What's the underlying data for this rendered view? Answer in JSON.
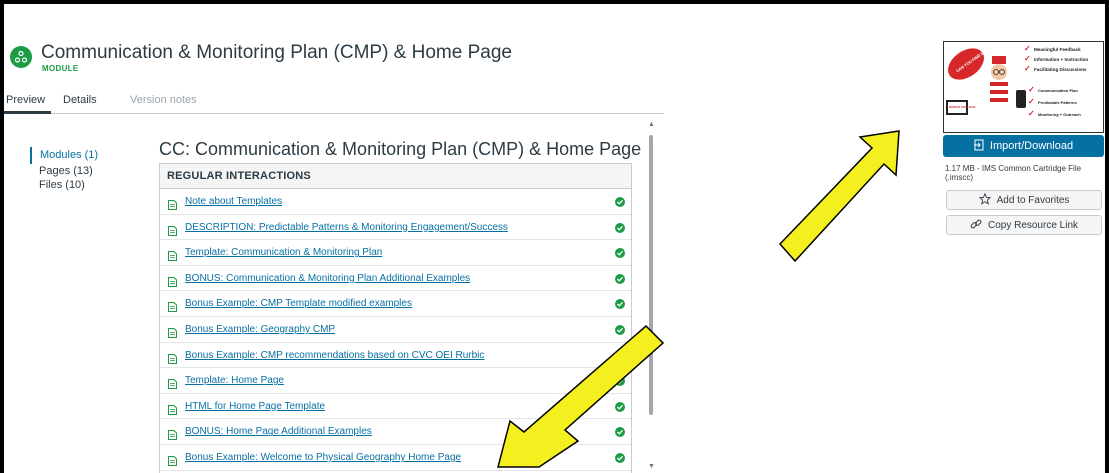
{
  "header": {
    "title": "Communication & Monitoring Plan (CMP) & Home Page",
    "type_badge": "MODULE",
    "icon": "module-icon"
  },
  "tabs": [
    {
      "label": "Preview",
      "active": true
    },
    {
      "label": "Details",
      "active": false
    },
    {
      "label": "Version notes",
      "active": false
    }
  ],
  "toc": [
    {
      "label": "Modules (1)",
      "active": true
    },
    {
      "label": "Pages (13)",
      "active": false
    },
    {
      "label": "Files (10)",
      "active": false
    }
  ],
  "preview": {
    "title": "CC: Communication & Monitoring Plan (CMP) & Home Page",
    "section_header": "REGULAR INTERACTIONS",
    "items": [
      {
        "label": "Note about Templates",
        "status": "complete"
      },
      {
        "label": "DESCRIPTION: Predictable Patterns & Monitoring Engagement/Success",
        "status": "complete"
      },
      {
        "label": "Template: Communication & Monitoring Plan",
        "status": "complete"
      },
      {
        "label": "BONUS: Communication & Monitoring Plan Additional Examples",
        "status": "complete"
      },
      {
        "label": "Bonus Example: CMP Template modified examples",
        "status": "complete"
      },
      {
        "label": "Bonus Example: Geography CMP",
        "status": "complete"
      },
      {
        "label": "Bonus Example: CMP recommendations based on CVC OEI Rurbic",
        "status": "complete"
      },
      {
        "label": "Template: Home Page",
        "status": "complete"
      },
      {
        "label": "HTML for Home Page Template",
        "status": "complete"
      },
      {
        "label": "BONUS: Home Page Additional Examples",
        "status": "complete"
      },
      {
        "label": "Bonus Example: Welcome to Physical Geography Home Page",
        "status": "complete"
      }
    ]
  },
  "sidebar": {
    "thumbnail": {
      "bubble": "CAN YOU FIND ME ONLINE?",
      "college": "NORCO COLLEGE",
      "bullets_top": [
        "Meaningful Feedback",
        "Information + Instruction",
        "Facilitating Discussions"
      ],
      "bullets_bottom": [
        "Communication Plan",
        "Predictable Patterns",
        "Monitoring + Outreach"
      ]
    },
    "import_label": "Import/Download",
    "file_meta": "1.17 MB - IMS Common Cartridge File (.imscc)",
    "favorites_label": "Add to Favorites",
    "copy_link_label": "Copy Resource Link"
  },
  "colors": {
    "accent": "#0770a3",
    "success": "#1d9b45",
    "annotation_arrow": "#f4f01f"
  }
}
